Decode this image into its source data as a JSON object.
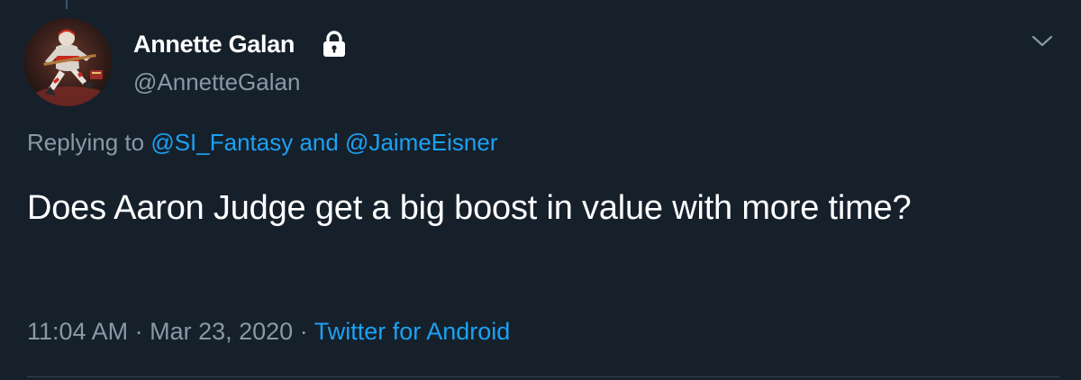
{
  "user": {
    "display_name": "Annette Galan",
    "handle": "@AnnetteGalan",
    "protected_icon": "lock-icon",
    "avatar_icon": "hockey-player-avatar"
  },
  "menu_icon": "chevron-down-icon",
  "reply": {
    "prefix": "Replying to ",
    "mention_1": "@SI_Fantasy",
    "conjunction": " and ",
    "mention_2": "@JaimeEisner"
  },
  "tweet": {
    "text": "Does Aaron Judge get a big boost in value with more time?"
  },
  "meta": {
    "time": "11:04 AM",
    "separator_1": " · ",
    "date": "Mar 23, 2020",
    "separator_2": " · ",
    "source": "Twitter for Android"
  },
  "colors": {
    "background": "#15202b",
    "text_primary": "#ffffff",
    "text_secondary": "#8899a6",
    "link": "#1da1f2",
    "divider": "#38444d"
  }
}
